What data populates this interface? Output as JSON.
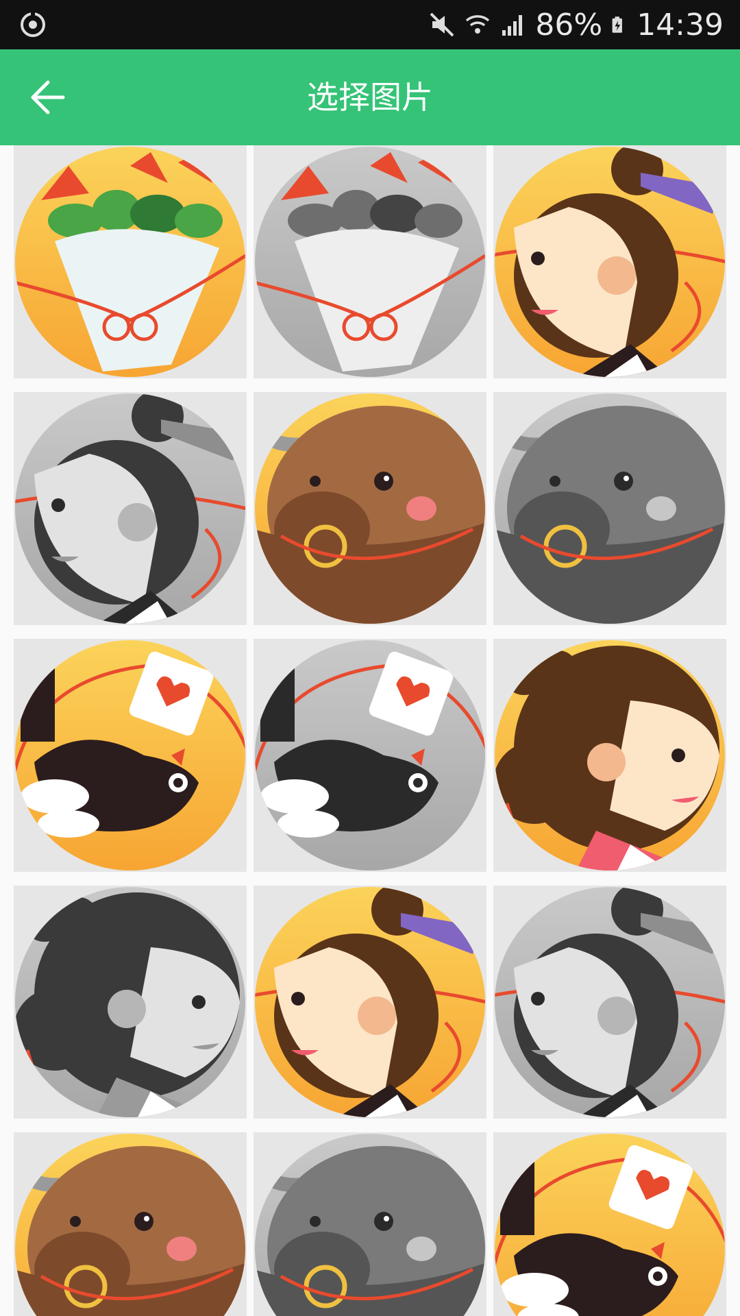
{
  "status_bar": {
    "battery": "86%",
    "time": "14:39",
    "icons": [
      "sync-icon",
      "mute-icon",
      "wifi-icon",
      "signal-icon",
      "battery-charging-icon"
    ]
  },
  "app_bar": {
    "title": "选择图片",
    "back_icon": "arrow-left-icon",
    "color": "#35c377"
  },
  "grid": {
    "columns": 3,
    "items": [
      {
        "name": "flower-bouquet",
        "style": "color"
      },
      {
        "name": "flower-bouquet",
        "style": "gray"
      },
      {
        "name": "boy",
        "style": "color"
      },
      {
        "name": "boy",
        "style": "gray"
      },
      {
        "name": "ox",
        "style": "color"
      },
      {
        "name": "ox",
        "style": "gray"
      },
      {
        "name": "magpie",
        "style": "color"
      },
      {
        "name": "magpie",
        "style": "gray"
      },
      {
        "name": "girl",
        "style": "color"
      },
      {
        "name": "girl",
        "style": "gray"
      },
      {
        "name": "boy",
        "style": "color"
      },
      {
        "name": "boy",
        "style": "gray"
      },
      {
        "name": "ox",
        "style": "color"
      },
      {
        "name": "ox",
        "style": "gray"
      },
      {
        "name": "magpie",
        "style": "color"
      }
    ]
  }
}
